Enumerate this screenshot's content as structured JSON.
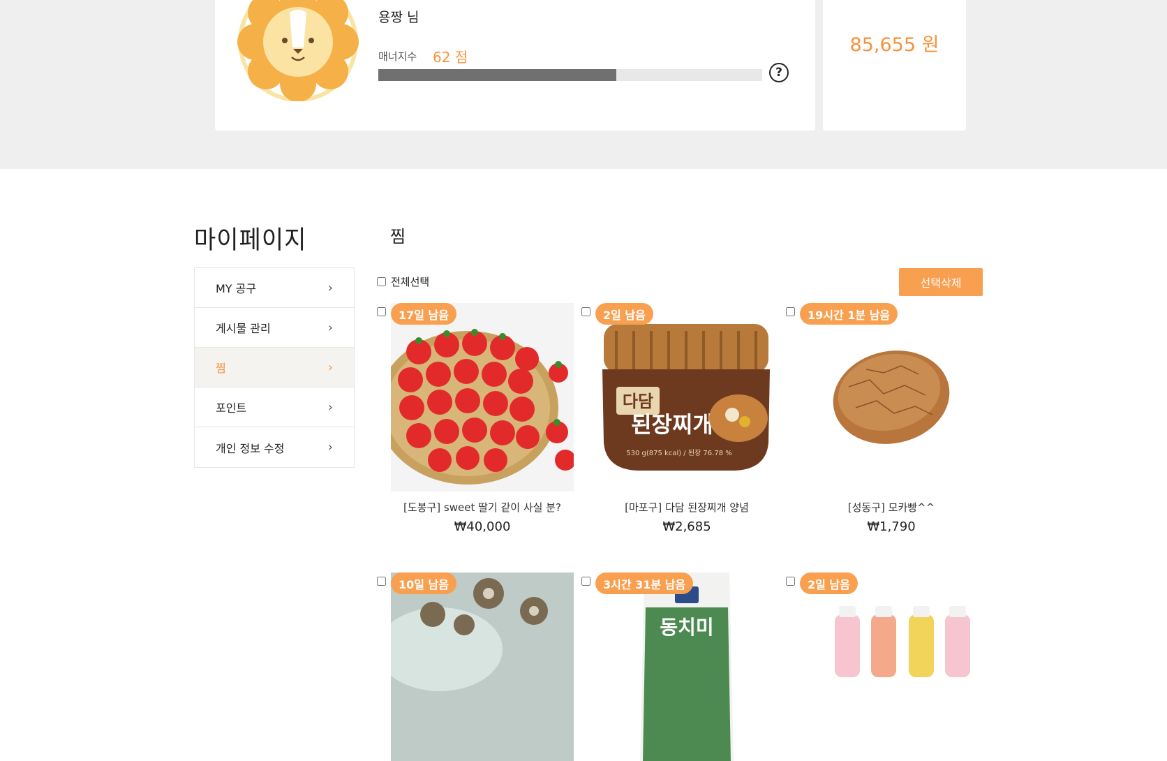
{
  "profile": {
    "name": "용짱 님",
    "manner_label": "매너지수",
    "manner_score": "62 점",
    "manner_progress": 0.62,
    "help": "?",
    "avatar_icon": "lion-avatar-icon"
  },
  "points": {
    "value": "85,655 원"
  },
  "sidebar": {
    "title": "마이페이지",
    "items": [
      {
        "label": "MY 공구",
        "active": false
      },
      {
        "label": "게시물 관리",
        "active": false
      },
      {
        "label": "찜",
        "active": true
      },
      {
        "label": "포인트",
        "active": false
      },
      {
        "label": "개인 정보 수정",
        "active": false
      }
    ]
  },
  "main": {
    "title": "찜",
    "select_all": "전체선택",
    "delete_selected": "선택삭제",
    "products": [
      {
        "badge": "17일 남음",
        "name": "[도봉구] sweet 딸기 같이 사실 분?",
        "price": "₩40,000",
        "image": "strawberry"
      },
      {
        "badge": "2일 남음",
        "name": "[마포구] 다담 된장찌개 양념",
        "price": "₩2,685",
        "image": "doenjang"
      },
      {
        "badge": "19시간 1분 남음",
        "name": "[성동구] 모카빵^^",
        "price": "₩1,790",
        "image": "mocha-bread"
      },
      {
        "badge": "10일 남음",
        "name": "",
        "price": "",
        "image": "seashell"
      },
      {
        "badge": "3시간 31분 남음",
        "name": "",
        "price": "",
        "image": "dongchimi"
      },
      {
        "badge": "2일 남음",
        "name": "",
        "price": "",
        "image": "drink-bottles"
      }
    ]
  },
  "colors": {
    "accent": "#f7923a",
    "button": "#f99f50",
    "band": "#efefef"
  }
}
